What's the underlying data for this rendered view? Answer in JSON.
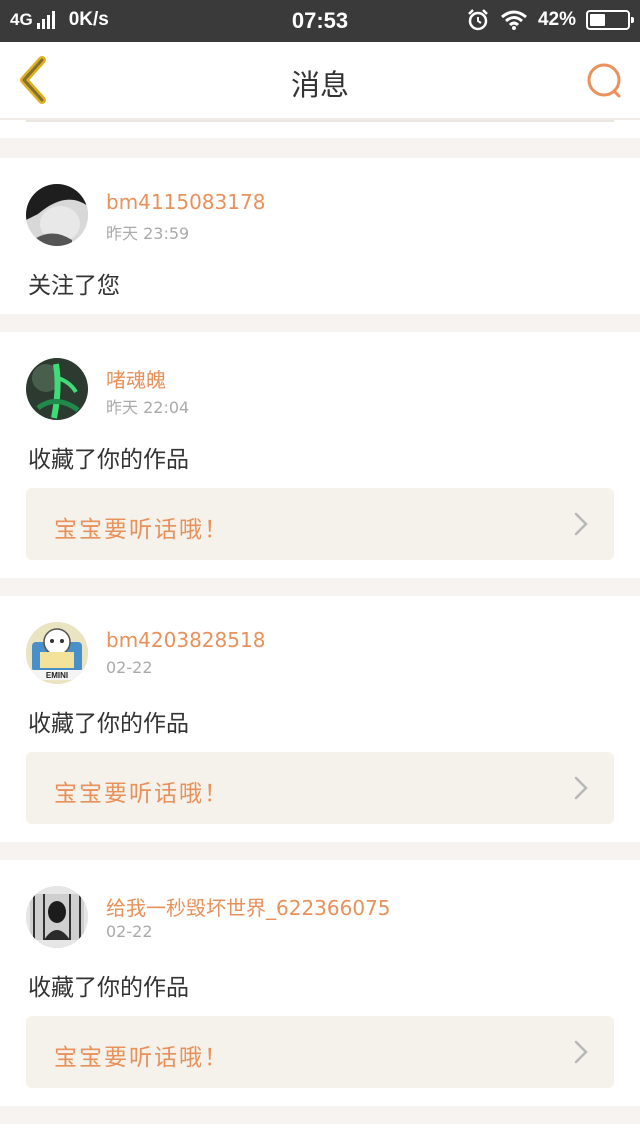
{
  "status_bar": {
    "network": "4G",
    "speed": "0K/s",
    "time": "07:53",
    "battery": "42%",
    "battery_level": 0.42
  },
  "header": {
    "title": "消息",
    "back_icon": "back-chevron-icon",
    "search_icon": "search-icon"
  },
  "colors": {
    "accent": "#e8915a",
    "back_icon": "#e0b020",
    "work_bg": "#f5f2ec"
  },
  "messages": [
    {
      "username": "bm4115083178",
      "time": "昨天 23:59",
      "action": "关注了您"
    },
    {
      "username": "啫魂魄",
      "time": "昨天 22:04",
      "action": "收藏了你的作品",
      "work_title": "宝宝要听话哦！"
    },
    {
      "username": "bm4203828518",
      "time": "02-22",
      "action": "收藏了你的作品",
      "work_title": "宝宝要听话哦！"
    },
    {
      "username": "给我一秒毁坏世界_622366075",
      "time": "02-22",
      "action": "收藏了你的作品",
      "work_title": "宝宝要听话哦！"
    }
  ]
}
